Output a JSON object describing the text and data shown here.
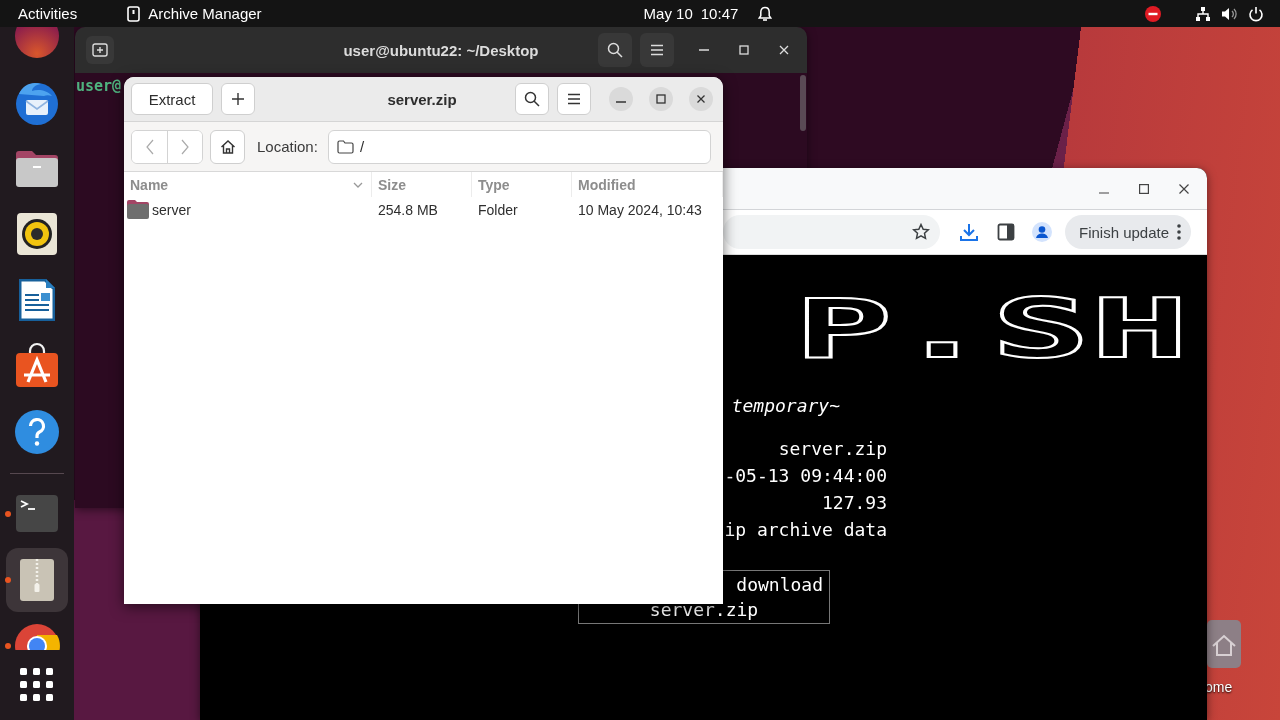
{
  "top_bar": {
    "activities": "Activities",
    "app_name": "Archive Manager",
    "date": "May 10",
    "time": "10:47"
  },
  "dock": {
    "favorites": [
      {
        "kind": "partial",
        "running": false,
        "selected": false
      },
      {
        "kind": "mail",
        "running": false,
        "selected": false
      },
      {
        "kind": "files",
        "running": false,
        "selected": false
      },
      {
        "kind": "music",
        "running": false,
        "selected": false
      },
      {
        "kind": "writer",
        "running": false,
        "selected": false
      },
      {
        "kind": "store",
        "running": false,
        "selected": false
      },
      {
        "kind": "help",
        "running": false,
        "selected": false
      }
    ],
    "apps": [
      {
        "kind": "terminal",
        "running": true,
        "selected": false
      },
      {
        "kind": "archive",
        "running": true,
        "selected": true
      },
      {
        "kind": "browser",
        "running": true,
        "selected": false
      }
    ]
  },
  "terminal_window": {
    "title": "user@ubuntu22: ~/Desktop",
    "prompt": "user@"
  },
  "browser_window": {
    "update_button": "Finish update",
    "page": {
      "banner": "P.SH",
      "tagline": "temporary~",
      "info_lines": [
        "server.zip",
        "-05-13 09:44:00",
        "127.93",
        "ip archive data"
      ],
      "download_box": [
        "download",
        "server.zip"
      ]
    }
  },
  "archive_window": {
    "title": "server.zip",
    "extract_button": "Extract",
    "location_label": "Location:",
    "location": "/",
    "columns": [
      {
        "label": "Name",
        "sorted": true
      },
      {
        "label": "Size",
        "sorted": false
      },
      {
        "label": "Type",
        "sorted": false
      },
      {
        "label": "Modified",
        "sorted": false
      }
    ],
    "rows": [
      {
        "kind": "folder",
        "name": "server",
        "size": "254.8 MB",
        "type": "Folder",
        "modified": "10 May 2024, 10:43",
        "selected": false
      }
    ]
  },
  "desktop_icons": [
    {
      "label": "ome"
    }
  ]
}
